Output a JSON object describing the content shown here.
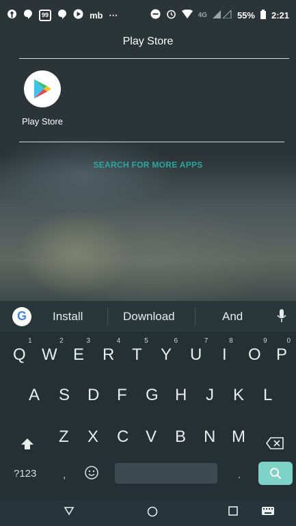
{
  "status_bar": {
    "badge_number": "99",
    "mb_label": "mb",
    "network_label": "4G",
    "battery": "55%",
    "time": "2:21"
  },
  "search": {
    "query": "Play Store"
  },
  "results": [
    {
      "label": "Play Store",
      "icon": "play-store-icon"
    }
  ],
  "more_apps_label": "SEARCH FOR MORE APPS",
  "keyboard": {
    "suggestions": [
      "Install",
      "Download",
      "And"
    ],
    "row1": [
      [
        "Q",
        "1"
      ],
      [
        "W",
        "2"
      ],
      [
        "E",
        "3"
      ],
      [
        "R",
        "4"
      ],
      [
        "T",
        "5"
      ],
      [
        "Y",
        "6"
      ],
      [
        "U",
        "7"
      ],
      [
        "I",
        "8"
      ],
      [
        "O",
        "9"
      ],
      [
        "P",
        "0"
      ]
    ],
    "row2": [
      "A",
      "S",
      "D",
      "F",
      "G",
      "H",
      "J",
      "K",
      "L"
    ],
    "row3": [
      "Z",
      "X",
      "C",
      "V",
      "B",
      "N",
      "M"
    ],
    "symbols_label": "?123",
    "comma": ",",
    "period": "."
  },
  "colors": {
    "accent": "#2aa8a1",
    "search_key": "#7dd3c8",
    "keyboard_bg": "#253034"
  }
}
